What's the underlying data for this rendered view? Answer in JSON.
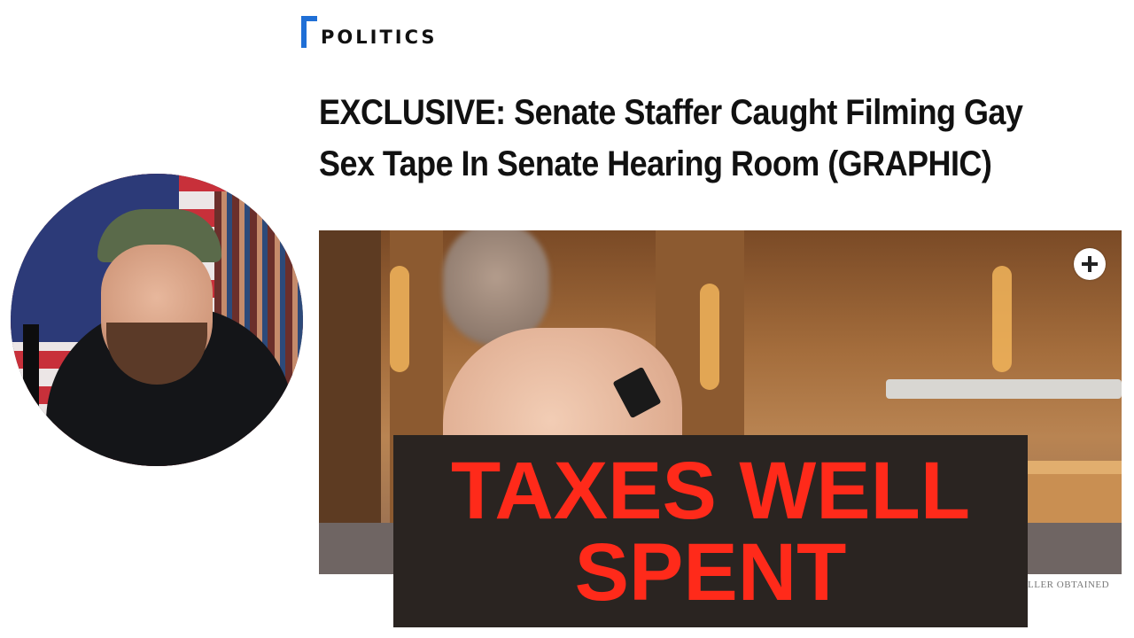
{
  "section": {
    "label": "POLITICS",
    "accent": "#1f6fd6"
  },
  "headline": {
    "line1": "EXCLUSIVE: Senate Staffer Caught Filming Gay",
    "line2": "Sex Tape In Senate Hearing Room (GRAPHIC)"
  },
  "image": {
    "expand_icon": "plus-circle-icon",
    "credit": "LLER OBTAINED"
  },
  "banner": {
    "line1": "TAXES WELL",
    "line2": "SPENT",
    "text_color": "#ff2a1a",
    "bg_color": "#2a2421"
  },
  "avatar": {
    "icon": "host-avatar-photo"
  }
}
